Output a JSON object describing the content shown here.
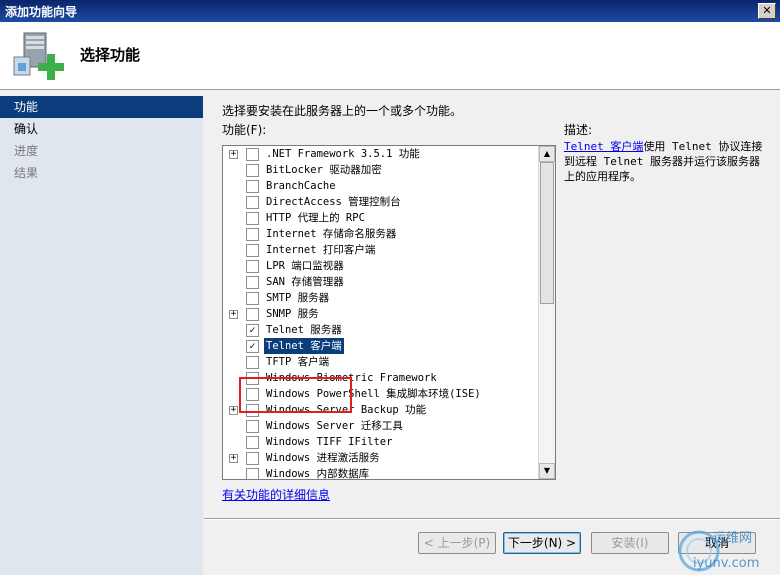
{
  "window": {
    "title": "添加功能向导",
    "close_glyph": "✕"
  },
  "header": {
    "heading": "选择功能"
  },
  "nav": {
    "items": [
      {
        "label": "功能",
        "state": "active"
      },
      {
        "label": "确认",
        "state": "normal"
      },
      {
        "label": "进度",
        "state": "disabled"
      },
      {
        "label": "结果",
        "state": "disabled"
      }
    ]
  },
  "main": {
    "intro": "选择要安装在此服务器上的一个或多个功能。",
    "list_label": "功能(F):",
    "features": [
      {
        "label": ".NET Framework 3.5.1 功能",
        "expandable": true,
        "checked": false
      },
      {
        "label": "BitLocker 驱动器加密",
        "expandable": false,
        "checked": false
      },
      {
        "label": "BranchCache",
        "expandable": false,
        "checked": false
      },
      {
        "label": "DirectAccess 管理控制台",
        "expandable": false,
        "checked": false
      },
      {
        "label": "HTTP 代理上的 RPC",
        "expandable": false,
        "checked": false
      },
      {
        "label": "Internet 存储命名服务器",
        "expandable": false,
        "checked": false
      },
      {
        "label": "Internet 打印客户端",
        "expandable": false,
        "checked": false
      },
      {
        "label": "LPR 端口监视器",
        "expandable": false,
        "checked": false
      },
      {
        "label": "SAN 存储管理器",
        "expandable": false,
        "checked": false
      },
      {
        "label": "SMTP 服务器",
        "expandable": false,
        "checked": false
      },
      {
        "label": "SNMP 服务",
        "expandable": true,
        "checked": false
      },
      {
        "label": "Telnet 服务器",
        "expandable": false,
        "checked": true
      },
      {
        "label": "Telnet 客户端",
        "expandable": false,
        "checked": true,
        "selected": true
      },
      {
        "label": "TFTP 客户端",
        "expandable": false,
        "checked": false
      },
      {
        "label": "Windows Biometric Framework",
        "expandable": false,
        "checked": false
      },
      {
        "label": "Windows PowerShell 集成脚本环境(ISE)",
        "expandable": false,
        "checked": false
      },
      {
        "label": "Windows Server Backup 功能",
        "expandable": true,
        "checked": false
      },
      {
        "label": "Windows Server 迁移工具",
        "expandable": false,
        "checked": false
      },
      {
        "label": "Windows TIFF IFilter",
        "expandable": false,
        "checked": false
      },
      {
        "label": "Windows 进程激活服务",
        "expandable": true,
        "checked": false
      },
      {
        "label": "Windows 内部数据库",
        "expandable": false,
        "checked": false
      }
    ],
    "more_info_link": "有关功能的详细信息",
    "description_label": "描述:",
    "description_link": "Telnet 客户端",
    "description_text": "使用 Telnet 协议连接到远程 Telnet 服务器并运行该服务器上的应用程序。"
  },
  "buttons": {
    "prev": "< 上一步(P)",
    "next": "下一步(N) >",
    "install": "安装(I)",
    "cancel": "取消"
  },
  "watermark": {
    "text1": "运维网",
    "text2": "iyunv.com"
  },
  "colors": {
    "nav_active": "#0b3c7c",
    "highlight_box": "#e02020",
    "link": "#0000ee"
  }
}
